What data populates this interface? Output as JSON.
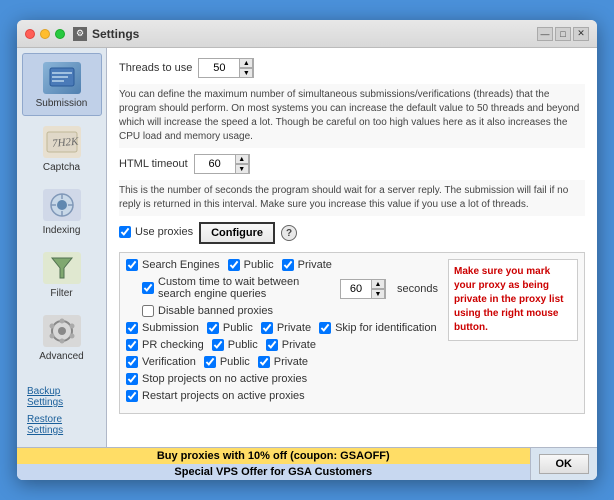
{
  "window": {
    "title": "Settings",
    "titlebar_controls": [
      "—",
      "□",
      "✕"
    ]
  },
  "sidebar": {
    "items": [
      {
        "label": "Submission",
        "key": "submission",
        "active": true
      },
      {
        "label": "Captcha",
        "key": "captcha",
        "active": false
      },
      {
        "label": "Indexing",
        "key": "indexing",
        "active": false
      },
      {
        "label": "Filter",
        "key": "filter",
        "active": false
      },
      {
        "label": "Advanced",
        "key": "advanced",
        "active": false
      }
    ],
    "bottom_items": [
      {
        "label": "Backup Settings"
      },
      {
        "label": "Restore Settings"
      }
    ]
  },
  "main": {
    "threads_label": "Threads to use",
    "threads_value": "50",
    "info_text_1": "You can define the maximum number of simultaneous submissions/verifications (threads) that the program should perform. On most systems you can increase the default value to 50 threads and beyond which will increase the speed a lot. Though be careful on too high values here as it also increases the CPU load and memory usage.",
    "html_timeout_label": "HTML timeout",
    "html_timeout_value": "60",
    "info_text_2": "This is the number of seconds the program should wait for a server reply. The submission will fail if no reply is returned in this interval. Make sure you increase this value if you use a lot of threads.",
    "use_proxies_label": "Use proxies",
    "configure_label": "Configure",
    "proxies": {
      "search_engines": {
        "label": "Search Engines",
        "public": "Public",
        "private": "Private",
        "checked": true
      },
      "custom_time": {
        "label": "Custom time to wait between search engine queries",
        "value": "60",
        "unit": "seconds",
        "checked": true
      },
      "disable_banned": {
        "label": "Disable banned proxies",
        "checked": false
      },
      "submission": {
        "label": "Submission",
        "public": "Public",
        "private": "Private",
        "skip_identification": "Skip for identification",
        "checked": true
      },
      "pr_checking": {
        "label": "PR checking",
        "public": "Public",
        "private": "Private",
        "checked": true
      },
      "verification": {
        "label": "Verification",
        "public": "Public",
        "private": "Private",
        "checked": true
      },
      "stop_projects": {
        "label": "Stop projects on no active proxies",
        "checked": true
      },
      "restart_projects": {
        "label": "Restart projects on active proxies",
        "checked": true
      }
    },
    "warning_text": "Make sure you mark your proxy as being private in the proxy list using the right mouse button."
  },
  "bottom": {
    "promo1": "Buy proxies with 10% off  (coupon: GSAOFF)",
    "promo2": "Special VPS Offer for GSA Customers",
    "ok_label": "OK"
  }
}
